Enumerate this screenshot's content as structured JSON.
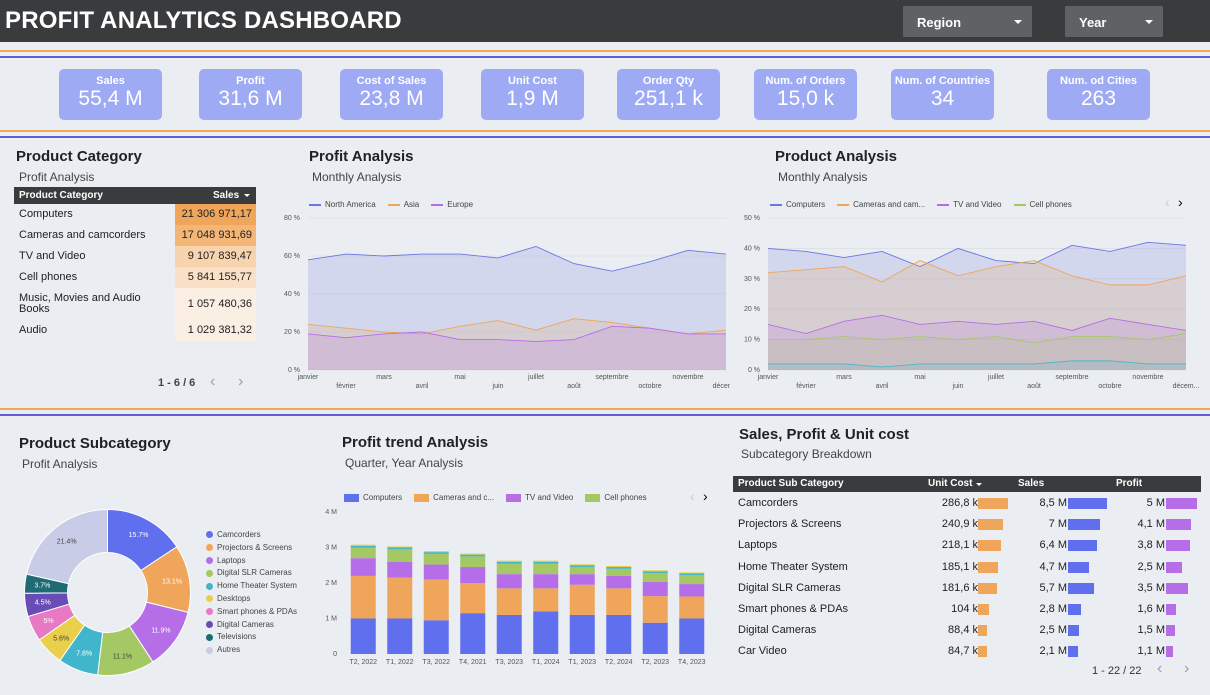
{
  "header": {
    "title": "PROFIT ANALYTICS DASHBOARD",
    "region_label": "Region",
    "year_label": "Year"
  },
  "kpis": [
    {
      "label": "Sales",
      "value": "55,4 M"
    },
    {
      "label": "Profit",
      "value": "31,6 M"
    },
    {
      "label": "Cost of Sales",
      "value": "23,8 M"
    },
    {
      "label": "Unit Cost",
      "value": "1,9 M"
    },
    {
      "label": "Order Qty",
      "value": "251,1 k"
    },
    {
      "label": "Num. of Orders",
      "value": "15,0 k"
    },
    {
      "label": "Num. of Countries",
      "value": "34"
    },
    {
      "label": "Num. od Cities",
      "value": "263"
    }
  ],
  "category": {
    "title": "Product Category",
    "subtitle": "Profit Analysis",
    "col_name": "Product Category",
    "col_sales": "Sales",
    "rows": [
      {
        "name": "Computers",
        "sales": "21 306 971,17",
        "color": "#f0a65a"
      },
      {
        "name": "Cameras and camcorders",
        "sales": "17 048 931,69",
        "color": "#f3b676"
      },
      {
        "name": "TV and Video",
        "sales": "9 107 839,47",
        "color": "#f7d4ae"
      },
      {
        "name": "Cell phones",
        "sales": "5 841 155,77",
        "color": "#f9e0c6"
      },
      {
        "name": "Music, Movies and Audio Books",
        "sales": "1 057 480,36",
        "color": "#fbefe3"
      },
      {
        "name": "Audio",
        "sales": "1 029 381,32",
        "color": "#fbefe3"
      }
    ],
    "pager": "1 - 6 / 6"
  },
  "profit_analysis": {
    "title": "Profit Analysis",
    "subtitle": "Monthly Analysis"
  },
  "product_analysis": {
    "title": "Product Analysis",
    "subtitle": "Monthly Analysis"
  },
  "subcategory": {
    "title": "Product Subcategory",
    "subtitle": "Profit Analysis"
  },
  "trend": {
    "title": "Profit trend Analysis",
    "subtitle": "Quarter, Year Analysis"
  },
  "spu": {
    "title": "Sales, Profit & Unit cost",
    "subtitle": "Subcategory Breakdown",
    "col_name": "Product Sub Category",
    "col_unit": "Unit Cost",
    "col_sales": "Sales",
    "col_profit": "Profit",
    "rows": [
      {
        "name": "Camcorders",
        "unit": "286,8 k",
        "sales": "8,5 M",
        "profit": "5 M",
        "unit_frac": 1.0,
        "sales_frac": 1.0,
        "profit_frac": 1.0
      },
      {
        "name": "Projectors & Screens",
        "unit": "240,9 k",
        "sales": "7 M",
        "profit": "4,1 M",
        "unit_frac": 0.84,
        "sales_frac": 0.82,
        "profit_frac": 0.82
      },
      {
        "name": "Laptops",
        "unit": "218,1 k",
        "sales": "6,4 M",
        "profit": "3,8 M",
        "unit_frac": 0.76,
        "sales_frac": 0.75,
        "profit_frac": 0.76
      },
      {
        "name": "Home Theater System",
        "unit": "185,1 k",
        "sales": "4,7 M",
        "profit": "2,5 M",
        "unit_frac": 0.65,
        "sales_frac": 0.55,
        "profit_frac": 0.5
      },
      {
        "name": "Digital SLR Cameras",
        "unit": "181,6 k",
        "sales": "5,7 M",
        "profit": "3,5 M",
        "unit_frac": 0.63,
        "sales_frac": 0.67,
        "profit_frac": 0.7
      },
      {
        "name": "Smart phones & PDAs",
        "unit": "104 k",
        "sales": "2,8 M",
        "profit": "1,6 M",
        "unit_frac": 0.36,
        "sales_frac": 0.33,
        "profit_frac": 0.32
      },
      {
        "name": "Digital Cameras",
        "unit": "88,4 k",
        "sales": "2,5 M",
        "profit": "1,5 M",
        "unit_frac": 0.31,
        "sales_frac": 0.29,
        "profit_frac": 0.3
      },
      {
        "name": "Car Video",
        "unit": "84,7 k",
        "sales": "2,1 M",
        "profit": "1,1 M",
        "unit_frac": 0.3,
        "sales_frac": 0.25,
        "profit_frac": 0.22
      }
    ],
    "pager": "1 - 22 / 22"
  },
  "colors": {
    "unit": "#f0a65a",
    "sales": "#5f6fee",
    "profit": "#b66ee8"
  },
  "chart_data": [
    {
      "type": "area",
      "id": "profit_analysis",
      "categories": [
        "janvier",
        "février",
        "mars",
        "avril",
        "mai",
        "juin",
        "juillet",
        "août",
        "septembre",
        "octobre",
        "novembre",
        "décem..."
      ],
      "series": [
        {
          "name": "North America",
          "color": "#6a77e0",
          "values": [
            58,
            61,
            60,
            61,
            61,
            59,
            65,
            56,
            52,
            57,
            63,
            61
          ]
        },
        {
          "name": "Asia",
          "color": "#f0a65a",
          "values": [
            24,
            22,
            20,
            19,
            23,
            26,
            21,
            27,
            25,
            22,
            19,
            21
          ]
        },
        {
          "name": "Europe",
          "color": "#b66ee8",
          "values": [
            19,
            17,
            19,
            20,
            16,
            16,
            15,
            16,
            23,
            22,
            19,
            19
          ]
        }
      ],
      "yticks": [
        "0 %",
        "20 %",
        "40 %",
        "60 %",
        "80 %"
      ],
      "ylim": [
        0,
        80
      ]
    },
    {
      "type": "area",
      "id": "product_analysis",
      "categories": [
        "janvier",
        "février",
        "mars",
        "avril",
        "mai",
        "juin",
        "juillet",
        "août",
        "septembre",
        "octobre",
        "novembre",
        "décem..."
      ],
      "series": [
        {
          "name": "Computers",
          "color": "#6a77e0",
          "values": [
            40,
            39,
            37,
            39,
            34,
            40,
            36,
            35,
            41,
            39,
            42,
            41
          ]
        },
        {
          "name": "Cameras and cam...",
          "color": "#f0a65a",
          "values": [
            32,
            33,
            34,
            29,
            36,
            31,
            34,
            36,
            31,
            28,
            28,
            31
          ]
        },
        {
          "name": "TV and Video",
          "color": "#b66ee8",
          "values": [
            15,
            12,
            16,
            18,
            15,
            16,
            15,
            16,
            13,
            17,
            15,
            13
          ]
        },
        {
          "name": "Cell phones",
          "color": "#a4c964",
          "values": [
            10,
            10,
            11,
            10,
            11,
            10,
            11,
            9,
            11,
            11,
            10,
            12
          ]
        },
        {
          "name": "",
          "color": "#4bb8c8",
          "values": [
            2,
            2,
            2,
            1,
            2,
            2,
            2,
            2,
            3,
            3,
            2,
            2
          ]
        }
      ],
      "yticks": [
        "0 %",
        "10 %",
        "20 %",
        "30 %",
        "40 %",
        "50 %"
      ],
      "ylim": [
        0,
        50
      ]
    },
    {
      "type": "pie",
      "id": "subcategory",
      "labels": [
        "Camcorders",
        "Projectors & Screens",
        "Laptops",
        "Digital SLR Cameras",
        "Home Theater System",
        "Desktops",
        "Smart phones & PDAs",
        "Digital Cameras",
        "Televisions",
        "Autres"
      ],
      "values": [
        15.7,
        13.1,
        11.9,
        11.1,
        7.8,
        5.6,
        5,
        4.5,
        3.7,
        21.4
      ],
      "value_labels": [
        "15.7%",
        "13.1%",
        "11.9%",
        "11.1%",
        "7.8%",
        "5.6%",
        "5%",
        "4.5%",
        "3.7%",
        "21.4%"
      ],
      "colors": [
        "#5f6fee",
        "#f0a65a",
        "#b66ee8",
        "#a4c964",
        "#40b6cc",
        "#e9cf4a",
        "#e879c4",
        "#6a4cb7",
        "#1f6b75",
        "#c8cce6"
      ]
    },
    {
      "type": "bar",
      "id": "trend",
      "categories": [
        "T2, 2022",
        "T1, 2022",
        "T3, 2022",
        "T4, 2021",
        "T3, 2023",
        "T1, 2024",
        "T1, 2023",
        "T2, 2024",
        "T2, 2023",
        "T4, 2023"
      ],
      "series": [
        {
          "name": "Computers",
          "color": "#5f6fee",
          "values": [
            1.0,
            1.0,
            0.95,
            1.15,
            1.1,
            1.2,
            1.1,
            1.1,
            0.88,
            1.0
          ]
        },
        {
          "name": "Cameras and c...",
          "color": "#f0a65a",
          "values": [
            1.2,
            1.15,
            1.15,
            0.85,
            0.75,
            0.65,
            0.85,
            0.75,
            0.75,
            0.62
          ]
        },
        {
          "name": "TV and Video",
          "color": "#b66ee8",
          "values": [
            0.5,
            0.45,
            0.42,
            0.45,
            0.4,
            0.4,
            0.3,
            0.35,
            0.4,
            0.35
          ]
        },
        {
          "name": "Cell phones",
          "color": "#a4c964",
          "values": [
            0.3,
            0.35,
            0.3,
            0.3,
            0.3,
            0.3,
            0.2,
            0.2,
            0.25,
            0.25
          ]
        },
        {
          "name": "",
          "color": "#40b6cc",
          "values": [
            0.05,
            0.05,
            0.05,
            0.05,
            0.05,
            0.05,
            0.05,
            0.05,
            0.05,
            0.05
          ]
        },
        {
          "name": "",
          "color": "#e9cf4a",
          "values": [
            0.03,
            0.03,
            0.03,
            0.03,
            0.03,
            0.03,
            0.03,
            0.03,
            0.03,
            0.03
          ]
        }
      ],
      "yticks": [
        "0",
        "1 M",
        "2 M",
        "3 M",
        "4 M"
      ],
      "ylim": [
        0,
        4
      ]
    }
  ]
}
